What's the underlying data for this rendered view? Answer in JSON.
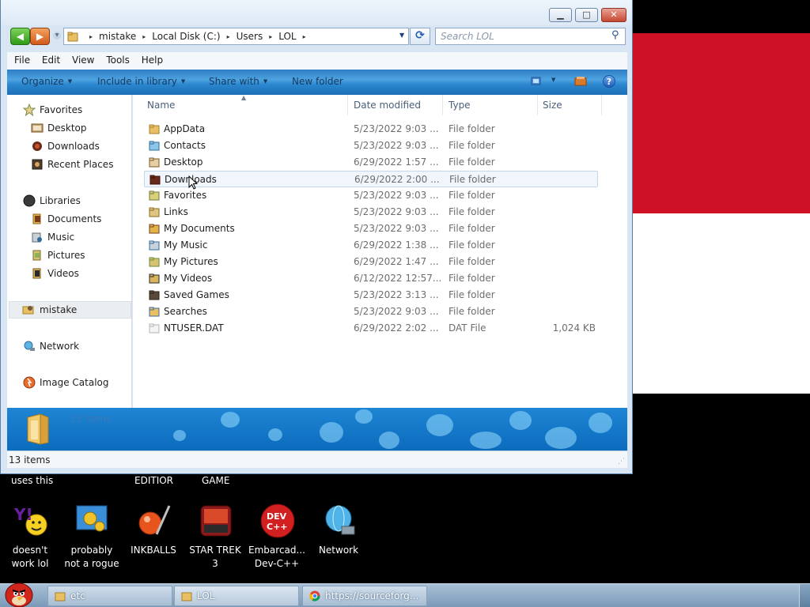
{
  "window": {
    "title_buttons": {
      "min": "▁",
      "max": "□",
      "close": "✕"
    },
    "address": {
      "crumbs": [
        "mistake",
        "Local Disk (C:)",
        "Users",
        "LOL"
      ],
      "separator": "▸"
    },
    "search_placeholder": "Search LOL",
    "menu": [
      "File",
      "Edit",
      "View",
      "Tools",
      "Help"
    ],
    "toolbar": {
      "organize": "Organize",
      "include": "Include in library",
      "share": "Share with",
      "newfolder": "New folder",
      "help": "?"
    },
    "nav": {
      "favorites": "Favorites",
      "desktop": "Desktop",
      "downloads": "Downloads",
      "recent": "Recent Places",
      "libraries": "Libraries",
      "documents": "Documents",
      "music": "Music",
      "pictures": "Pictures",
      "videos": "Videos",
      "user": "mistake",
      "network": "Network",
      "catalog": "Image Catalog"
    },
    "columns": {
      "name": "Name",
      "date": "Date modified",
      "type": "Type",
      "size": "Size"
    },
    "files": [
      {
        "name": "AppData",
        "date": "5/23/2022 9:03 ...",
        "type": "File folder",
        "size": "",
        "icon": "folder-icon"
      },
      {
        "name": "Contacts",
        "date": "5/23/2022 9:03 ...",
        "type": "File folder",
        "size": "",
        "icon": "contacts-icon"
      },
      {
        "name": "Desktop",
        "date": "6/29/2022 1:57 ...",
        "type": "File folder",
        "size": "",
        "icon": "desktop-icon"
      },
      {
        "name": "Downloads",
        "date": "6/29/2022 2:00 ...",
        "type": "File folder",
        "size": "",
        "icon": "downloads-icon"
      },
      {
        "name": "Favorites",
        "date": "5/23/2022 9:03 ...",
        "type": "File folder",
        "size": "",
        "icon": "star-icon"
      },
      {
        "name": "Links",
        "date": "5/23/2022 9:03 ...",
        "type": "File folder",
        "size": "",
        "icon": "links-icon"
      },
      {
        "name": "My Documents",
        "date": "5/23/2022 9:03 ...",
        "type": "File folder",
        "size": "",
        "icon": "documents-icon"
      },
      {
        "name": "My Music",
        "date": "6/29/2022 1:38 ...",
        "type": "File folder",
        "size": "",
        "icon": "music-icon"
      },
      {
        "name": "My Pictures",
        "date": "6/29/2022 1:47 ...",
        "type": "File folder",
        "size": "",
        "icon": "pictures-icon"
      },
      {
        "name": "My Videos",
        "date": "6/12/2022 12:57...",
        "type": "File folder",
        "size": "",
        "icon": "videos-icon"
      },
      {
        "name": "Saved Games",
        "date": "5/23/2022 3:13 ...",
        "type": "File folder",
        "size": "",
        "icon": "games-icon"
      },
      {
        "name": "Searches",
        "date": "5/23/2022 9:03 ...",
        "type": "File folder",
        "size": "",
        "icon": "search-folder-icon"
      },
      {
        "name": "NTUSER.DAT",
        "date": "6/29/2022 2:02 ...",
        "type": "DAT File",
        "size": "1,024 KB",
        "icon": "file-icon"
      }
    ],
    "details_count": "13 items",
    "status": "13 items"
  },
  "desktop": {
    "labels": {
      "uses_this": "uses this",
      "editior": "EDITIOR",
      "game": "GAME"
    },
    "icons": [
      {
        "label1": "doesn't",
        "label2": "work lol",
        "icon": "yahoo-messenger-icon"
      },
      {
        "label1": "probably",
        "label2": "not a rogue",
        "icon": "gears-program-icon"
      },
      {
        "label1": "INKBALLS",
        "label2": "",
        "icon": "inkball-icon"
      },
      {
        "label1": "STAR TREK",
        "label2": "3",
        "icon": "star-trek-icon"
      },
      {
        "label1": "Embarcad...",
        "label2": "Dev-C++",
        "icon": "devcpp-icon"
      },
      {
        "label1": "Network",
        "label2": "",
        "icon": "network-globe-icon"
      }
    ]
  },
  "taskbar": {
    "tasks": [
      {
        "label": "etc",
        "icon": "folder-icon"
      },
      {
        "label": "LOL",
        "icon": "folder-icon"
      },
      {
        "label": "https://sourceforg...",
        "icon": "chrome-icon"
      }
    ]
  },
  "colors": {
    "flag_red": "#ce1126",
    "flag_white": "#ffffff",
    "flag_black": "#000000",
    "toolbar_blue": "#2a86cf"
  }
}
